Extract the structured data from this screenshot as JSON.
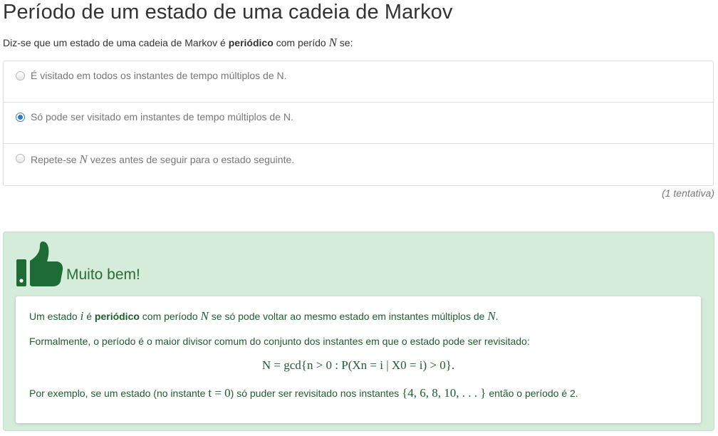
{
  "question": {
    "title": "Período de um estado de uma cadeia de Markov",
    "prompt_before": "Diz-se que um estado de uma cadeia de Markov é ",
    "prompt_bold": "periódico",
    "prompt_mid": " com perído ",
    "prompt_var": "N",
    "prompt_after": " se:"
  },
  "options": [
    {
      "text_before": "É visitado em todos os instantes de tempo múltiplos de N.",
      "var": "",
      "text_after": "",
      "selected": false
    },
    {
      "text_before": "Só pode ser visitado em instantes de tempo múltiplos de N.",
      "var": "",
      "text_after": "",
      "selected": true
    },
    {
      "text_before": "Repete-se ",
      "var": "N",
      "text_after": " vezes antes de seguir para o estado seguinte.",
      "selected": false
    }
  ],
  "attempts_label": "(1 tentativa)",
  "feedback": {
    "icon": "thumbs-up-icon",
    "title": "Muito bem!",
    "line1": {
      "t1": "Um estado ",
      "v1": "i",
      "t2": " é ",
      "bold": "periódico",
      "t3": " com período ",
      "v2": "N",
      "t4": " se só pode voltar ao mesmo estado em instantes múltiplos de ",
      "v3": "N",
      "t5": "."
    },
    "line2": "Formalmente, o período é o maior divisor comum do conjunto dos instantes em que o estado pode ser revisitado:",
    "formula": "N = gcd{n > 0 : P(Xn = i | X0 = i) > 0}.",
    "line3": {
      "t1": "Por exemplo, se um estado (no instante ",
      "m1": "t = 0",
      "t2": ") só puder ser revisitado nos instantes ",
      "m2": "{4, 6, 8, 10, . . . }",
      "t3": " então o período é 2."
    }
  },
  "colors": {
    "feedback_bg": "#d4ecd9",
    "feedback_text": "#1e5e2e",
    "icon": "#1f6b36",
    "radio_selected": "#2f78d4"
  }
}
